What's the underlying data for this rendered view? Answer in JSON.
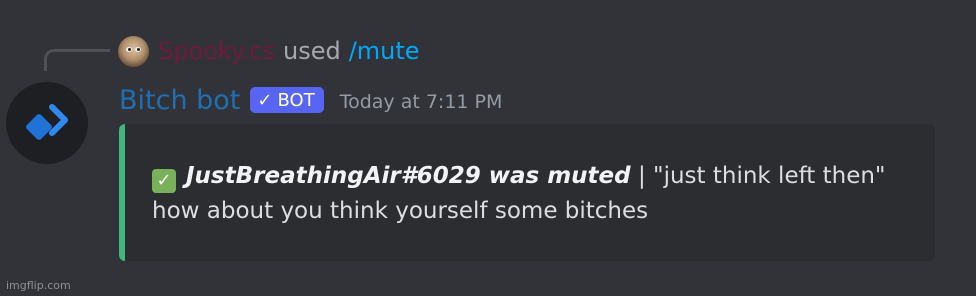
{
  "reply": {
    "username": "Spooky.cs",
    "verb": "used",
    "command": "/mute"
  },
  "message": {
    "author": "Bitch bot",
    "bot_tag": "BOT",
    "timestamp": "Today at 7:11 PM"
  },
  "embed": {
    "accent_color": "#43b581",
    "icon": "white-check-mark-icon",
    "bold_text": "JustBreathingAir#6029 was muted",
    "separator": "|",
    "reason_text": "\"just think left then\" how about you think yourself some bitches"
  },
  "watermark": "imgflip.com"
}
